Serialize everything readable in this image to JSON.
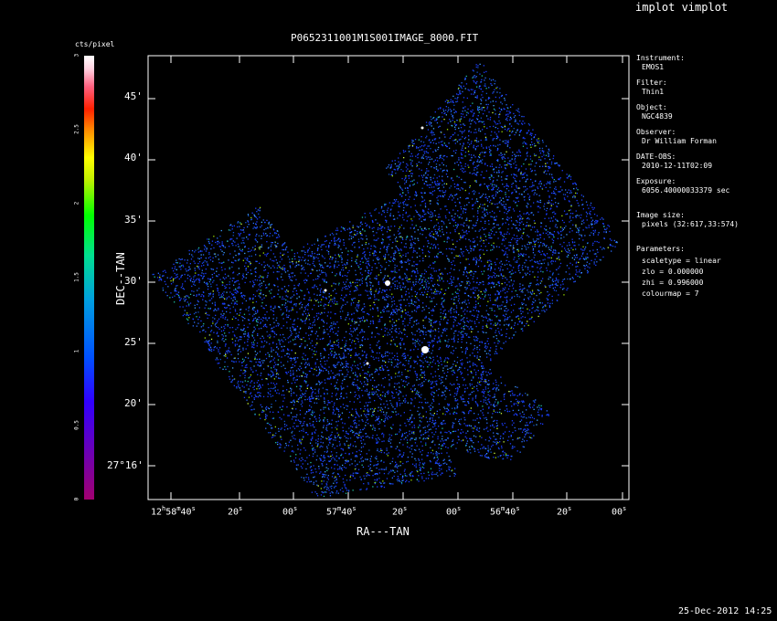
{
  "window": {
    "title": "implot vimplot",
    "timestamp": "25-Dec-2012 14:25"
  },
  "plot": {
    "title": "P0652311001M1S001IMAGE_8000.FIT",
    "colorbar": {
      "label": "cts/pixel",
      "ticks": [
        "0",
        "0.5",
        "1",
        "1.5",
        "2",
        "2.5",
        "3"
      ],
      "min": 0,
      "max": 3
    },
    "xaxis": {
      "label": "RA---TAN"
    },
    "yaxis": {
      "label": "DEC--TAN",
      "ticks": [
        "45'",
        "40'",
        "35'",
        "30'",
        "25'",
        "20'",
        "27°16'"
      ]
    }
  },
  "metadata": [
    {
      "label": "Instrument:",
      "value": "EMOS1"
    },
    {
      "label": "Filter:",
      "value": "Thin1"
    },
    {
      "label": "Object:",
      "value": "NGC4839"
    },
    {
      "label": "Observer:",
      "value": "Dr William Forman"
    },
    {
      "label": "DATE-OBS:",
      "value": "2010-12-11T02:09"
    },
    {
      "label": "Exposure:",
      "value": "6056.40000033379 sec"
    },
    {
      "label": "Image size:",
      "value": "pixels (32:617,33:574)"
    }
  ],
  "parameters": {
    "label": "Parameters:",
    "lines": [
      "scaletype = linear",
      "zlo = 0.000000",
      "zhi = 0.996000",
      "colourmap =   7"
    ]
  }
}
